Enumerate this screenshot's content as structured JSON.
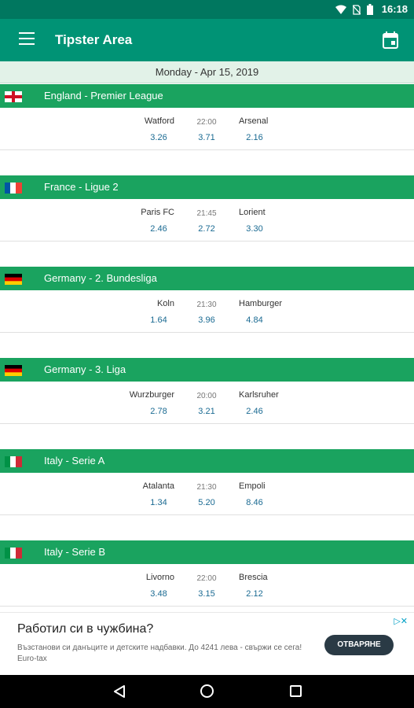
{
  "status_bar": {
    "time": "16:18"
  },
  "app_bar": {
    "title": "Tipster Area"
  },
  "date_bar": {
    "label": "Monday - Apr 15, 2019"
  },
  "leagues": [
    {
      "name": "England - Premier League",
      "flag": "england",
      "home": "Watford",
      "time": "22:00",
      "away": "Arsenal",
      "odd1": "3.26",
      "oddx": "3.71",
      "odd2": "2.16"
    },
    {
      "name": "France - Ligue 2",
      "flag": "france",
      "home": "Paris FC",
      "time": "21:45",
      "away": "Lorient",
      "odd1": "2.46",
      "oddx": "2.72",
      "odd2": "3.30"
    },
    {
      "name": "Germany - 2. Bundesliga",
      "flag": "germany",
      "home": "Koln",
      "time": "21:30",
      "away": "Hamburger",
      "odd1": "1.64",
      "oddx": "3.96",
      "odd2": "4.84"
    },
    {
      "name": "Germany - 3. Liga",
      "flag": "germany",
      "home": "Wurzburger",
      "time": "20:00",
      "away": "Karlsruher",
      "odd1": "2.78",
      "oddx": "3.21",
      "odd2": "2.46"
    },
    {
      "name": "Italy - Serie A",
      "flag": "italy",
      "home": "Atalanta",
      "time": "21:30",
      "away": "Empoli",
      "odd1": "1.34",
      "oddx": "5.20",
      "odd2": "8.46"
    },
    {
      "name": "Italy - Serie B",
      "flag": "italy",
      "home": "Livorno",
      "time": "22:00",
      "away": "Brescia",
      "odd1": "3.48",
      "oddx": "3.15",
      "odd2": "2.12"
    }
  ],
  "ad": {
    "headline": "Работил си в чужбина?",
    "description": "Възстанови си данъците и детските надбавки. До 4241 лева - свържи се сега! Euro-tax",
    "cta": "ОТВАРЯНЕ"
  },
  "colors": {
    "status_bar": "#00775f",
    "app_bar": "#009375",
    "league_header": "#1aa35f",
    "odds": "#1a6a92"
  }
}
